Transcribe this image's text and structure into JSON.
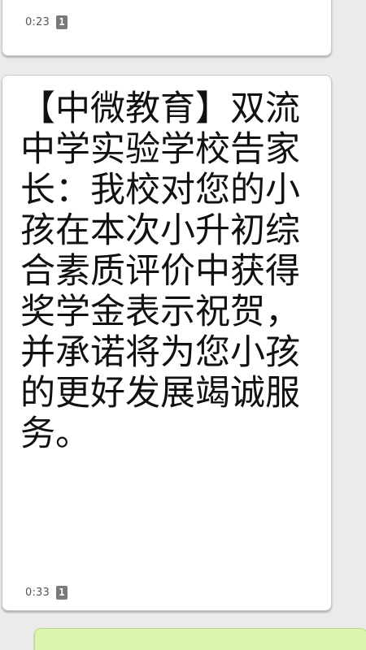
{
  "messages": [
    {
      "time": "0:23",
      "sim": "1"
    },
    {
      "text": "【中微教育】双流中学实验学校告家长：我校对您的小孩在本次小升初综合素质评价中获得奖学金表示祝贺，并承诺将为您小孩的更好发展竭诚服务。",
      "time": "0:33",
      "sim": "1"
    }
  ],
  "colors": {
    "background": "#ebebeb",
    "incoming_bubble": "#ffffff",
    "outgoing_bubble": "#d9f5b0"
  }
}
